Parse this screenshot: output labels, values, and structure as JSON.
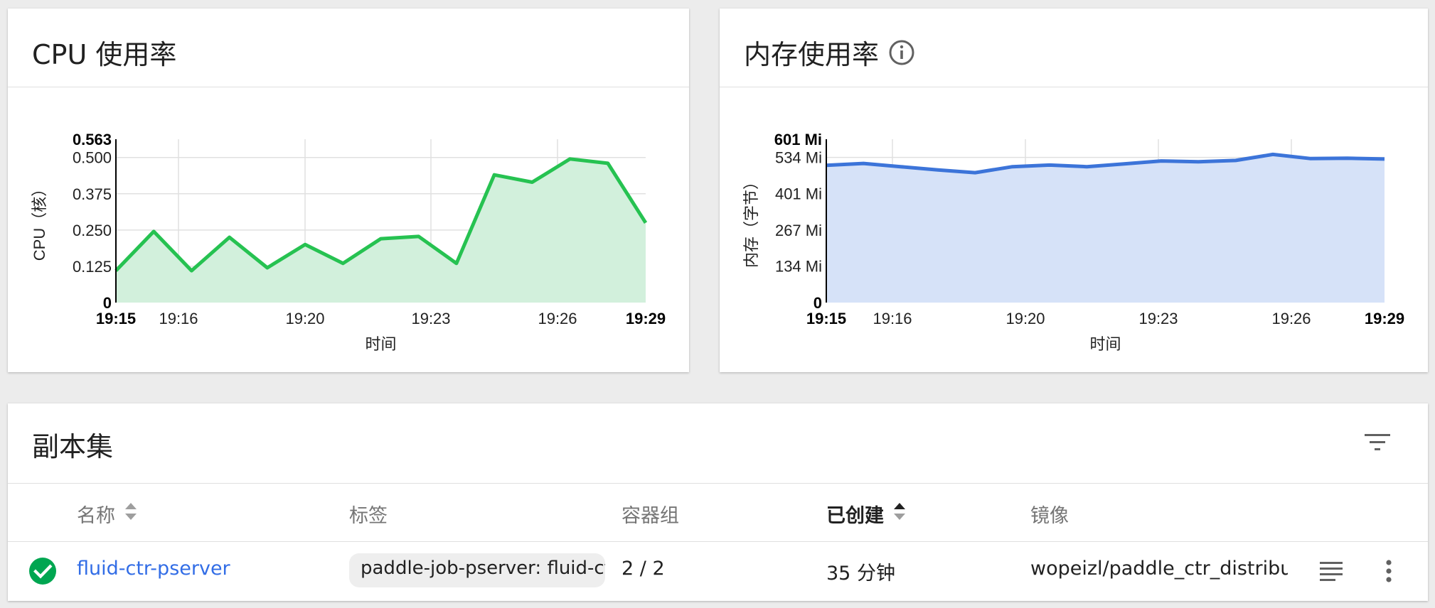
{
  "cpu_card": {
    "title": "CPU 使用率",
    "chart_data": {
      "type": "area",
      "title": "CPU 使用率",
      "xlabel": "时间",
      "ylabel": "CPU（核）",
      "x_ticks": [
        "19:15",
        "19:16",
        "19:20",
        "19:23",
        "19:26",
        "19:29"
      ],
      "y_ticks": [
        "0",
        "0.125",
        "0.250",
        "0.375",
        "0.500",
        "0.563"
      ],
      "ylim": [
        0,
        0.563
      ],
      "color": "#26c251",
      "fill": "#d2f0dc",
      "x": [
        "19:15",
        "",
        "19:16",
        "",
        "19:20",
        "",
        "19:20",
        "",
        "19:23",
        "",
        "19:23",
        "",
        "19:26",
        "",
        "19:26"
      ],
      "values": [
        0.11,
        0.245,
        0.11,
        0.225,
        0.12,
        0.2,
        0.135,
        0.22,
        0.228,
        0.135,
        0.44,
        0.415,
        0.495,
        0.48,
        0.275
      ]
    }
  },
  "memory_card": {
    "title": "内存使用率",
    "info_icon": "info-icon",
    "chart_data": {
      "type": "area",
      "title": "内存使用率",
      "xlabel": "时间",
      "ylabel": "内存（字节）",
      "x_ticks": [
        "19:15",
        "19:16",
        "19:20",
        "19:23",
        "19:26",
        "19:29"
      ],
      "y_ticks": [
        "0",
        "134 Mi",
        "267 Mi",
        "401 Mi",
        "534 Mi",
        "601 Mi"
      ],
      "ylim": [
        0,
        601
      ],
      "color": "#3c74d9",
      "fill": "#d6e2f8",
      "values": [
        505,
        512,
        500,
        488,
        478,
        500,
        506,
        500,
        510,
        521,
        518,
        523,
        545,
        530,
        531,
        528
      ]
    }
  },
  "replica_sets": {
    "title": "副本集",
    "filter_icon": "filter-icon",
    "columns": {
      "name": "名称",
      "labels": "标签",
      "pods": "容器组",
      "created": "已创建",
      "image": "镜像"
    },
    "rows": [
      {
        "status": "ok",
        "name": "fluid-ctr-pserver",
        "label": "paddle-job-pserver: fluid-ct",
        "pods": "2 / 2",
        "created": "35 分钟",
        "image": "wopeizl/paddle_ctr_distribu"
      }
    ],
    "colors": {
      "link": "#326de6",
      "success": "#00a651"
    }
  }
}
